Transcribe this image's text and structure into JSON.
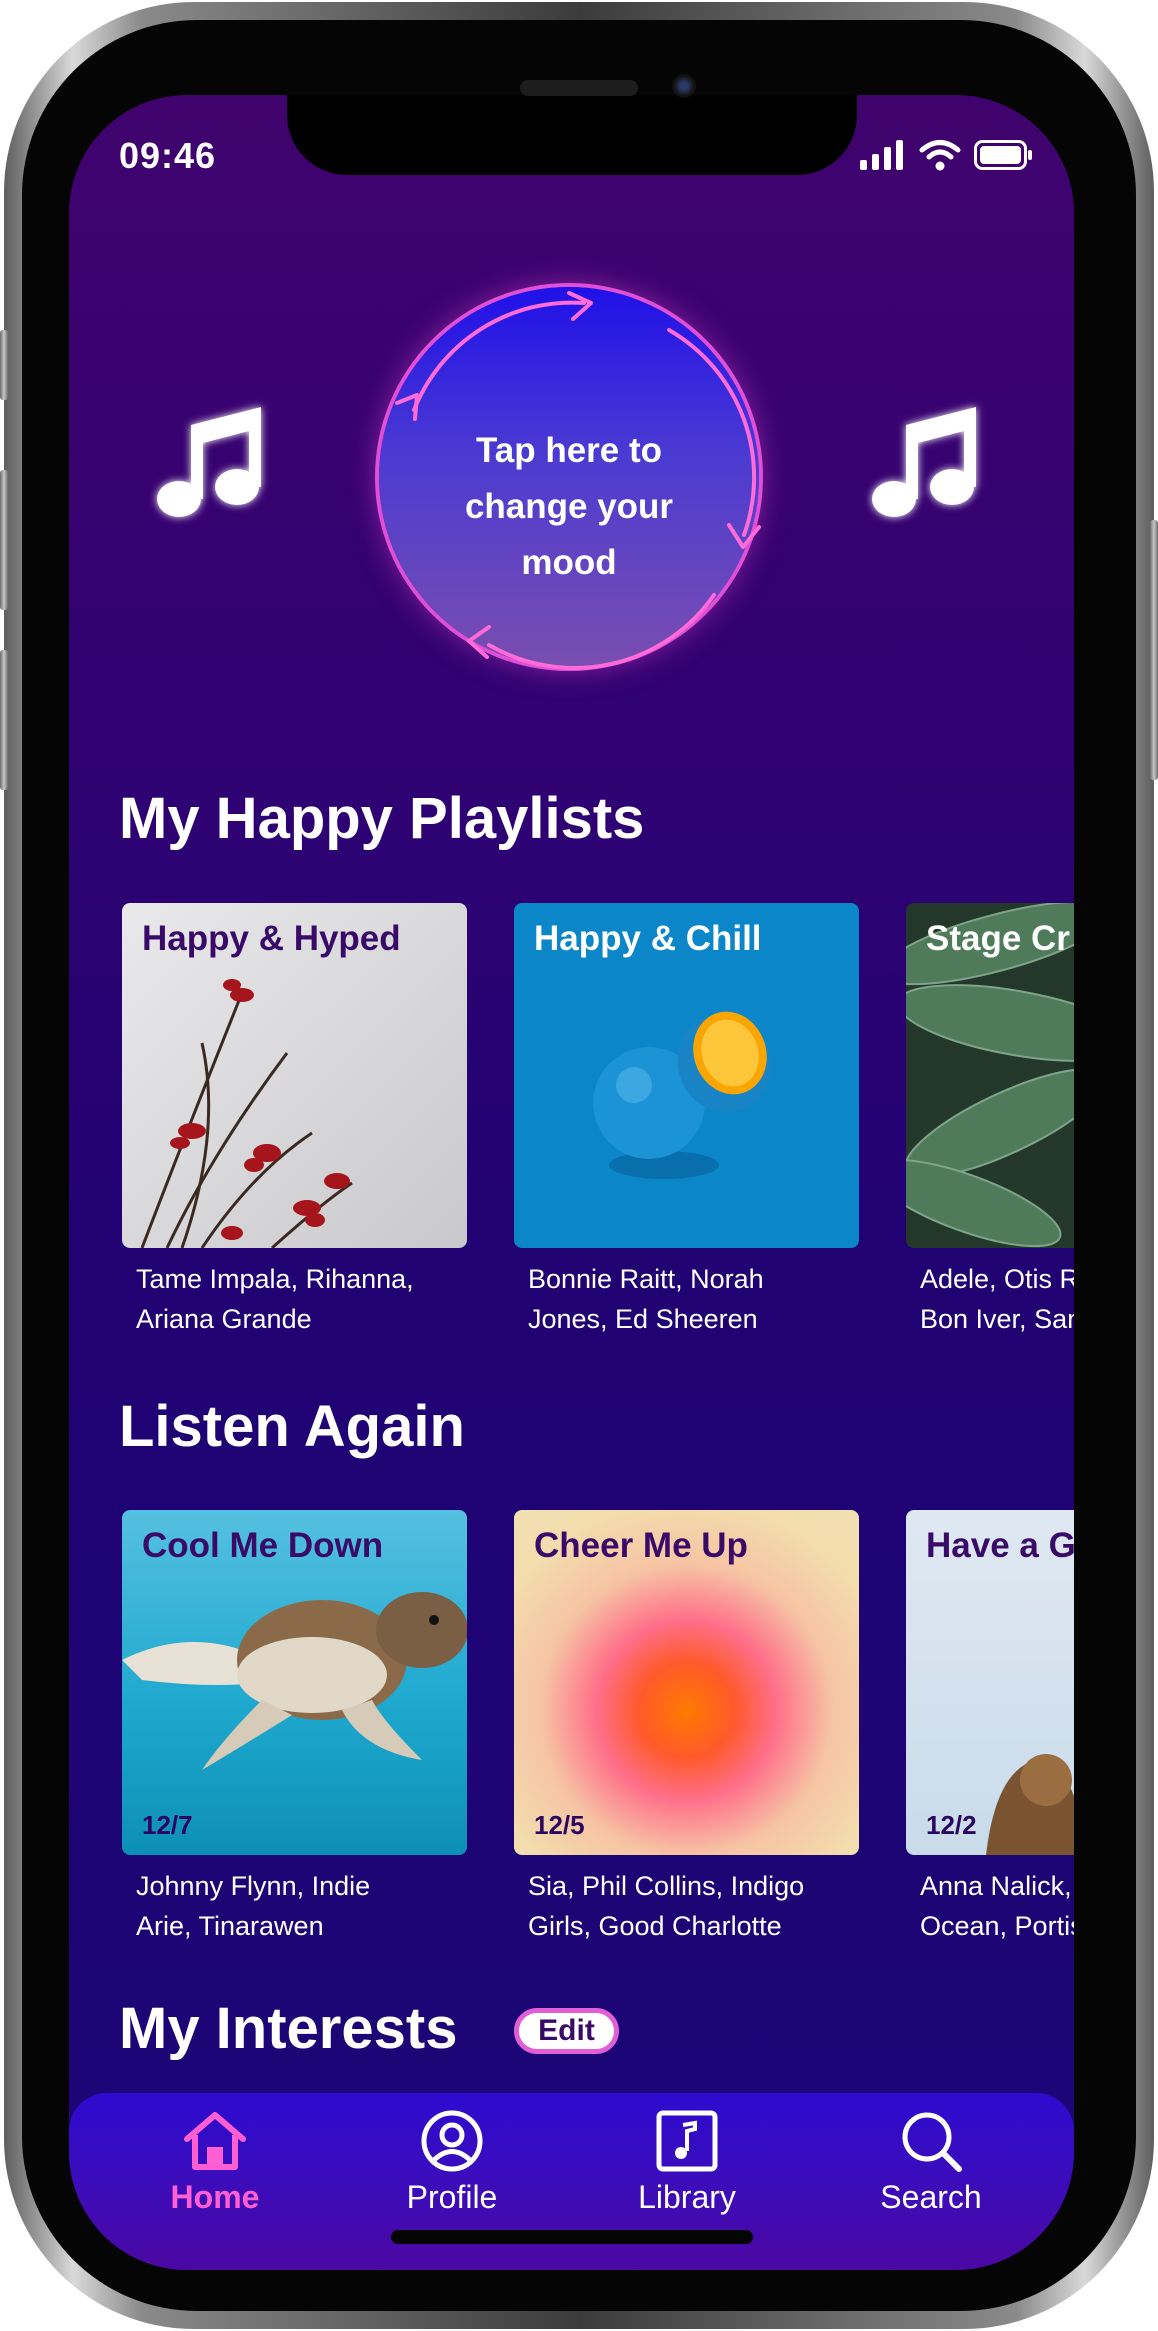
{
  "status_bar": {
    "time": "09:46"
  },
  "mood": {
    "prompt": "Tap here to change your mood"
  },
  "sections": {
    "playlists_title": "My Happy Playlists",
    "listen_again_title": "Listen Again",
    "interests_title": "My Interests",
    "edit_label": "Edit"
  },
  "playlists": [
    {
      "title": "Happy & Hyped",
      "artists_line1": "Tame Impala, Rihanna,",
      "artists_line2": "Ariana Grande"
    },
    {
      "title": "Happy & Chill",
      "artists_line1": "Bonnie Raitt, Norah",
      "artists_line2": "Jones, Ed Sheeren"
    },
    {
      "title": "Stage Cr",
      "artists_line1": "Adele, Otis R",
      "artists_line2": "Bon Iver, San"
    }
  ],
  "listen_again": [
    {
      "title": "Cool Me Down",
      "date": "12/7",
      "artists_line1": "Johnny Flynn, Indie",
      "artists_line2": "Arie, Tinarawen"
    },
    {
      "title": "Cheer Me Up",
      "date": "12/5",
      "artists_line1": "Sia, Phil Collins, Indigo",
      "artists_line2": "Girls, Good Charlotte"
    },
    {
      "title": "Have a G",
      "date": "12/2",
      "artists_line1": "Anna Nalick,",
      "artists_line2": "Ocean, Portis"
    }
  ],
  "nav": [
    {
      "label": "Home",
      "icon": "home-icon",
      "active": true
    },
    {
      "label": "Profile",
      "icon": "profile-icon",
      "active": false
    },
    {
      "label": "Library",
      "icon": "library-icon",
      "active": false
    },
    {
      "label": "Search",
      "icon": "search-icon",
      "active": false
    }
  ],
  "colors": {
    "background_top": "#40036e",
    "background_bottom": "#1b0676",
    "accent_pink": "#ff5fd2",
    "card_title_dark": "#3a0a68",
    "nav_bar": "#3d0cb8"
  }
}
